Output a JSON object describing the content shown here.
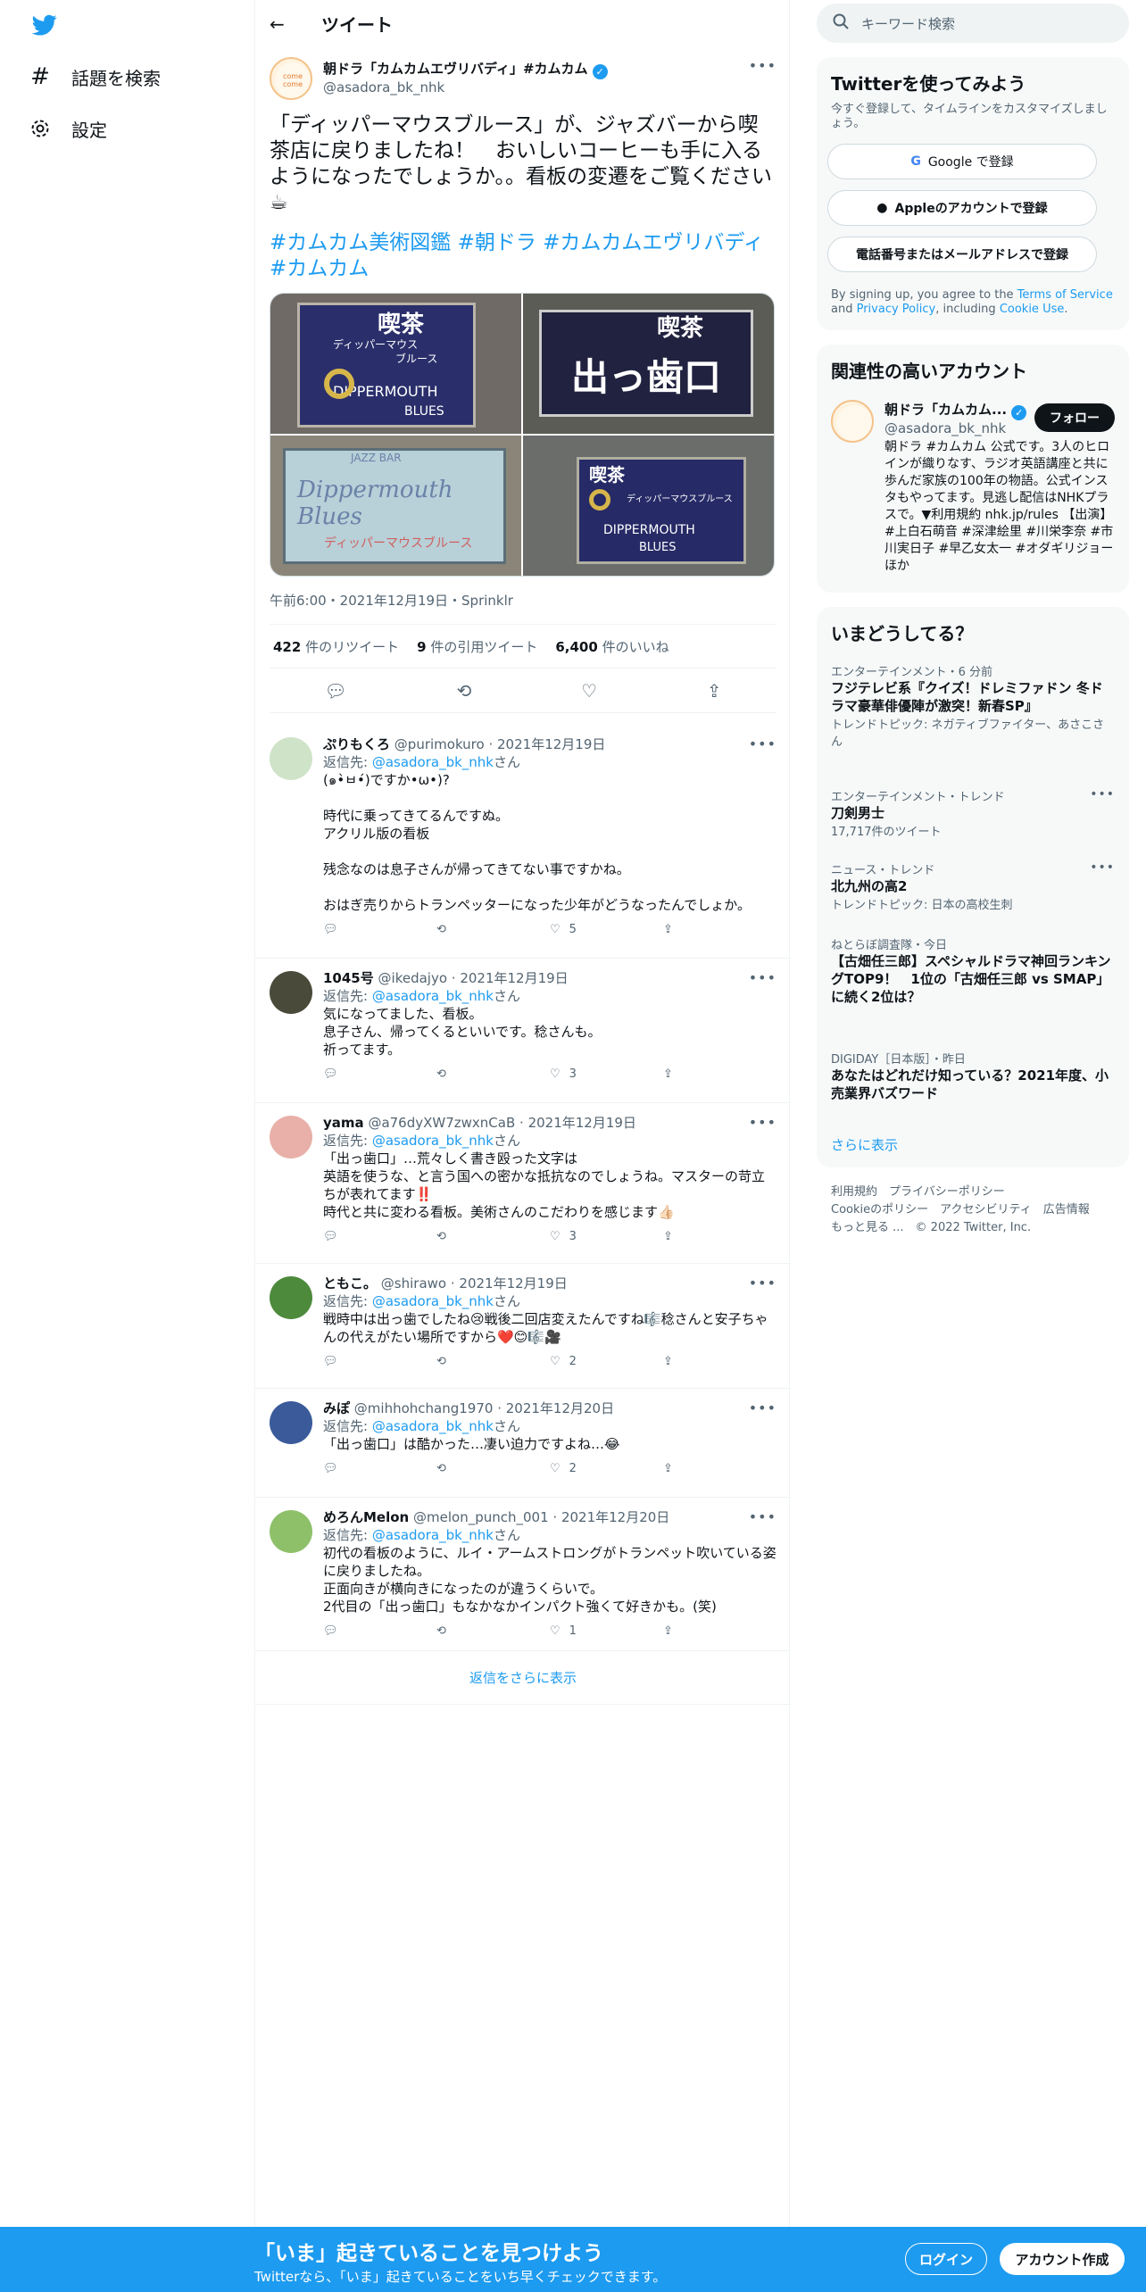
{
  "nav": {
    "explore": "話題を検索",
    "settings": "設定"
  },
  "header": {
    "title": "ツイート"
  },
  "tweet": {
    "name": "朝ドラ「カムカムエヴリバディ」#カムカム",
    "handle": "@asadora_bk_nhk",
    "text": "「ディッパーマウスブルース」が、ジャズバーから喫茶店に戻りましたね！　おいしいコーヒーも手に入るようになったでしょうか。。看板の変遷をご覧ください☕",
    "hashtags": "#カムカム美術図鑑 #朝ドラ #カムカムエヴリバディ #カムカム",
    "meta": "午前6:00・2021年12月19日・Sprinklr",
    "retweets": "422",
    "retweets_label": "件のリツイート",
    "quotes": "9",
    "quotes_label": "件の引用ツイート",
    "likes": "6,400",
    "likes_label": "件のいいね",
    "photos": [
      {
        "line1": "喫茶",
        "line2": "ディッパーマウス",
        "line3": "ブルース",
        "line4": "DIPPERMOUTH",
        "line5": "BLUES"
      },
      {
        "line1": "喫茶",
        "line2": "出っ歯口"
      },
      {
        "line1": "JAZZ BAR",
        "line2": "Dippermouth Blues",
        "line3": "ディッパーマウスブルース"
      },
      {
        "line1": "喫茶",
        "line2": "ディッパーマウスブルース",
        "line3": "DIPPERMOUTH",
        "line4": "BLUES"
      }
    ]
  },
  "replies": [
    {
      "name": "ぷりもくろ",
      "handle": "@purimokuro",
      "date": "2021年12月19日",
      "reply_to": "@asadora_bk_nhk",
      "reply_prefix": "返信先: ",
      "reply_suffix": "さん",
      "text": "(๑•̀ㅂ•́)ですか•ω•)?\n\n時代に乗ってきてるんですぬ。\nアクリル版の看板\n\n残念なのは息子さんが帰ってきてない事ですかね。\n\nおはぎ売りからトランペッターになった少年がどうなったんでしょか。",
      "likes": "5"
    },
    {
      "name": "1045号",
      "handle": "@ikedajyo",
      "date": "2021年12月19日",
      "reply_to": "@asadora_bk_nhk",
      "reply_prefix": "返信先: ",
      "reply_suffix": "さん",
      "text": "気になってました、看板。\n息子さん、帰ってくるといいです。稔さんも。\n祈ってます。",
      "likes": "3"
    },
    {
      "name": "yama",
      "handle": "@a76dyXW7zwxnCaB",
      "date": "2021年12月19日",
      "reply_to": "@asadora_bk_nhk",
      "reply_prefix": "返信先: ",
      "reply_suffix": "さん",
      "text": "「出っ歯口」…荒々しく書き殴った文字は\n英語を使うな、と言う国への密かな抵抗なのでしょうね。マスターの苛立ちが表れてます‼️\n時代と共に変わる看板。美術さんのこだわりを感じます👍🏻",
      "likes": "3"
    },
    {
      "name": "ともこ。",
      "handle": "@shirawo",
      "date": "2021年12月19日",
      "reply_to": "@asadora_bk_nhk",
      "reply_prefix": "返信先: ",
      "reply_suffix": "さん",
      "text": "戦時中は出っ歯でしたね😢戦後二回店変えたんですね🎼稔さんと安子ちゃんの代えがたい場所ですから❤️😊🎼🎥",
      "likes": "2"
    },
    {
      "name": "みぽ",
      "handle": "@mihhohchang1970",
      "date": "2021年12月20日",
      "reply_to": "@asadora_bk_nhk",
      "reply_prefix": "返信先: ",
      "reply_suffix": "さん",
      "text": "「出っ歯口」は酷かった…凄い迫力ですよね…😂",
      "likes": "2"
    },
    {
      "name": "めろんMelon",
      "handle": "@melon_punch_001",
      "date": "2021年12月20日",
      "reply_to": "@asadora_bk_nhk",
      "reply_prefix": "返信先: ",
      "reply_suffix": "さん",
      "text": "初代の看板のように、ルイ・アームストロングがトランペット吹いている姿に戻りましたね。\n正面向きが横向きになったのが違うくらいで。\n2代目の「出っ歯口」もなかなかインパクト強くて好きかも。(笑)",
      "likes": "1"
    }
  ],
  "show_more_replies": "返信をさらに表示",
  "search": {
    "placeholder": "キーワード検索"
  },
  "signup": {
    "title": "Twitterを使ってみよう",
    "subtitle": "今すぐ登録して、タイムラインをカスタマイズしましょう。",
    "google": "Google で登録",
    "apple": "Appleのアカウントで登録",
    "phone": "電話番号またはメールアドレスで登録",
    "terms_prefix": "By signing up, you agree to the ",
    "terms": "Terms of Service",
    "and": " and ",
    "privacy": "Privacy Policy",
    "including": ", including ",
    "cookie": "Cookie Use",
    "period": "."
  },
  "related": {
    "title": "関連性の高いアカウント",
    "name": "朝ドラ「カムカム...",
    "handle": "@asadora_bk_nhk",
    "follow": "フォロー",
    "bio": "朝ドラ #カムカム 公式です。3人のヒロインが織りなす、ラジオ英語講座と共に歩んだ家族の100年の物語。公式インスタもやってます。見逃し配信はNHKプラスで。▼利用規約 nhk.jp/rules 【出演】#上白石萌音 #深津絵里 #川栄李奈 #市川実日子 #早乙女太一 #オダギリジョー ほか"
  },
  "trends": {
    "title": "いまどうしてる？",
    "items": [
      {
        "cat": "エンターテインメント・6 分前",
        "title": "フジテレビ系『クイズ！ドレミファドン 冬ドラマ豪華俳優陣が激突！新春SP』",
        "sub": "トレンドトピック: ネガティブファイター、あさこさん"
      },
      {
        "cat": "エンターテインメント・トレンド",
        "title": "刀剣男士",
        "sub": "17,717件のツイート"
      },
      {
        "cat": "ニュース・トレンド",
        "title": "北九州の高2",
        "sub": "トレンドトピック: 日本の高校生刺"
      },
      {
        "cat": "ねとらぼ調査隊・今日",
        "title": "【古畑任三郎】スペシャルドラマ神回ランキングTOP9！　1位の「古畑任三郎 vs SMAP」に続く2位は？",
        "sub": ""
      },
      {
        "cat": "DIGIDAY［日本版］・昨日",
        "title": "あなたはどれだけ知っている？2021年度、小売業界バズワード",
        "sub": ""
      }
    ],
    "more": "さらに表示"
  },
  "footer": {
    "l1": "利用規約",
    "l2": "プライバシーポリシー",
    "l3": "Cookieのポリシー",
    "l4": "アクセシビリティ",
    "l5": "広告情報",
    "l6": "もっと見る ...",
    "copy": "© 2022 Twitter, Inc."
  },
  "bottombar": {
    "headline": "「いま」起きていることを見つけよう",
    "sub": "Twitterなら、「いま」起きていることをいち早くチェックできます。",
    "login": "ログイン",
    "signup": "アカウント作成"
  },
  "colors": {
    "accent": "#1d9bf0",
    "text": "#0f1419",
    "muted": "#536471"
  }
}
